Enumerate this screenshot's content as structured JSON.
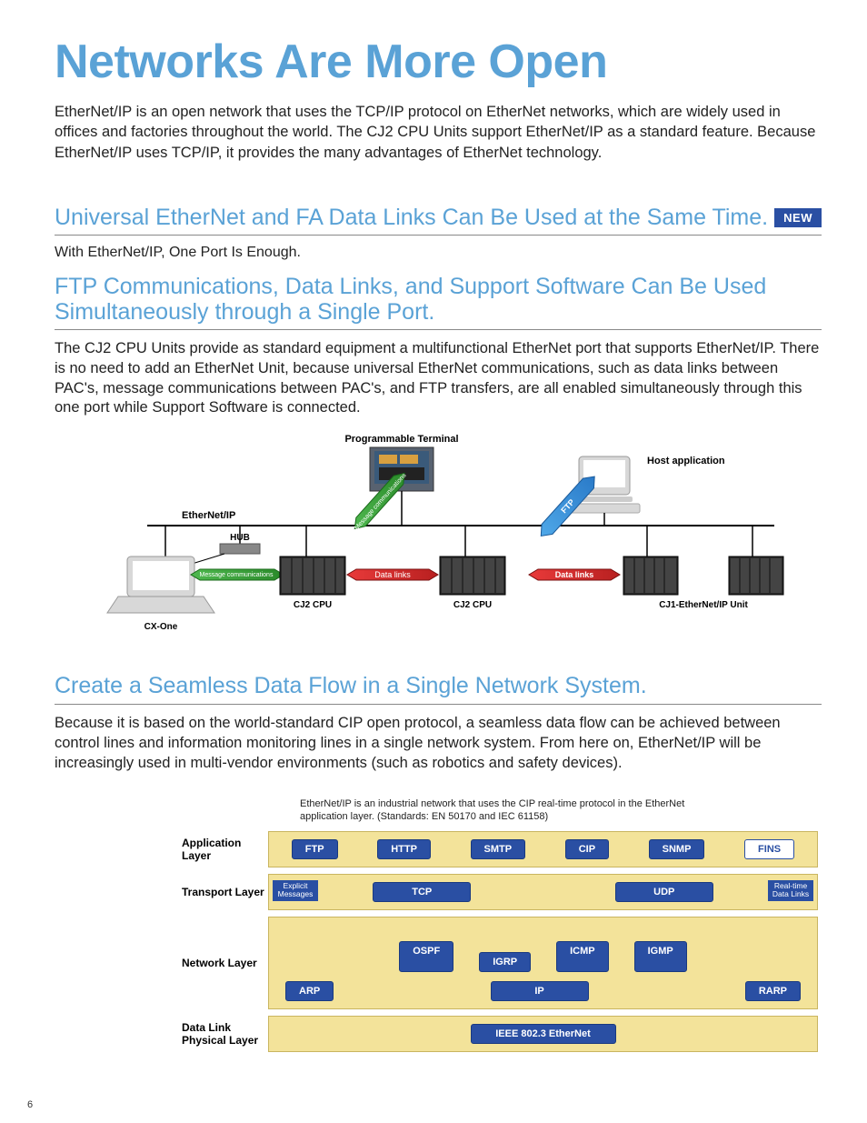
{
  "page_number": "6",
  "title": "Networks Are More Open",
  "intro": "EtherNet/IP is an open network that uses the TCP/IP protocol on EtherNet networks, which are widely used in offices and factories throughout the world. The CJ2 CPU Units support EtherNet/IP as a standard feature. Because EtherNet/IP uses TCP/IP, it provides the many advantages of EtherNet technology.",
  "section1": {
    "heading": "Universal EtherNet and FA Data Links Can Be Used at the Same Time.",
    "badge": "NEW",
    "subtext": "With EtherNet/IP, One Port Is Enough."
  },
  "section2": {
    "heading": "FTP Communications, Data Links, and Support Software Can Be Used Simultaneously through a Single Port.",
    "body": "The CJ2 CPU Units provide as standard equipment a multifunctional EtherNet port that supports EtherNet/IP. There is no need to add an EtherNet Unit, because universal EtherNet communications, such as data links between PAC's, message communications between PAC's, and FTP transfers, are all enabled simultaneously through this one port while Support Software is connected."
  },
  "diagram1": {
    "labels": {
      "prog_terminal": "Programmable Terminal",
      "host_app": "Host application",
      "ethernet_ip": "EtherNet/IP",
      "hub": "HUB",
      "msg_comm": "Message communications",
      "data_links": "Data links",
      "ftp": "FTP",
      "cj2_cpu": "CJ2 CPU",
      "cj1_unit": "CJ1-EtherNet/IP Unit",
      "cx_one": "CX-One"
    }
  },
  "section3": {
    "heading": "Create a Seamless Data Flow in a Single Network System.",
    "body": "Because it is based on the world-standard CIP open protocol, a seamless data flow can be achieved between control lines and information monitoring lines in a single network system. From here on, EtherNet/IP will be increasingly used in multi-vendor environments (such as robotics and safety devices)."
  },
  "stack": {
    "note": "EtherNet/IP is an industrial network that uses the CIP real-time protocol in the EtherNet application layer. (Standards: EN 50170 and IEC 61158)",
    "layers": {
      "app": "Application Layer",
      "transport": "Transport Layer",
      "network": "Network Layer",
      "datalink": "Data Link Physical Layer"
    },
    "protocols": {
      "ftp": "FTP",
      "http": "HTTP",
      "smtp": "SMTP",
      "cip": "CIP",
      "snmp": "SNMP",
      "fins": "FINS",
      "tcp": "TCP",
      "udp": "UDP",
      "ospf": "OSPF",
      "igrp": "IGRP",
      "icmp": "ICMP",
      "igmp": "IGMP",
      "arp": "ARP",
      "ip": "IP",
      "rarp": "RARP",
      "ieee": "IEEE 802.3 EtherNet"
    },
    "tags": {
      "explicit": "Explicit Messages",
      "realtime": "Real-time Data Links"
    }
  }
}
